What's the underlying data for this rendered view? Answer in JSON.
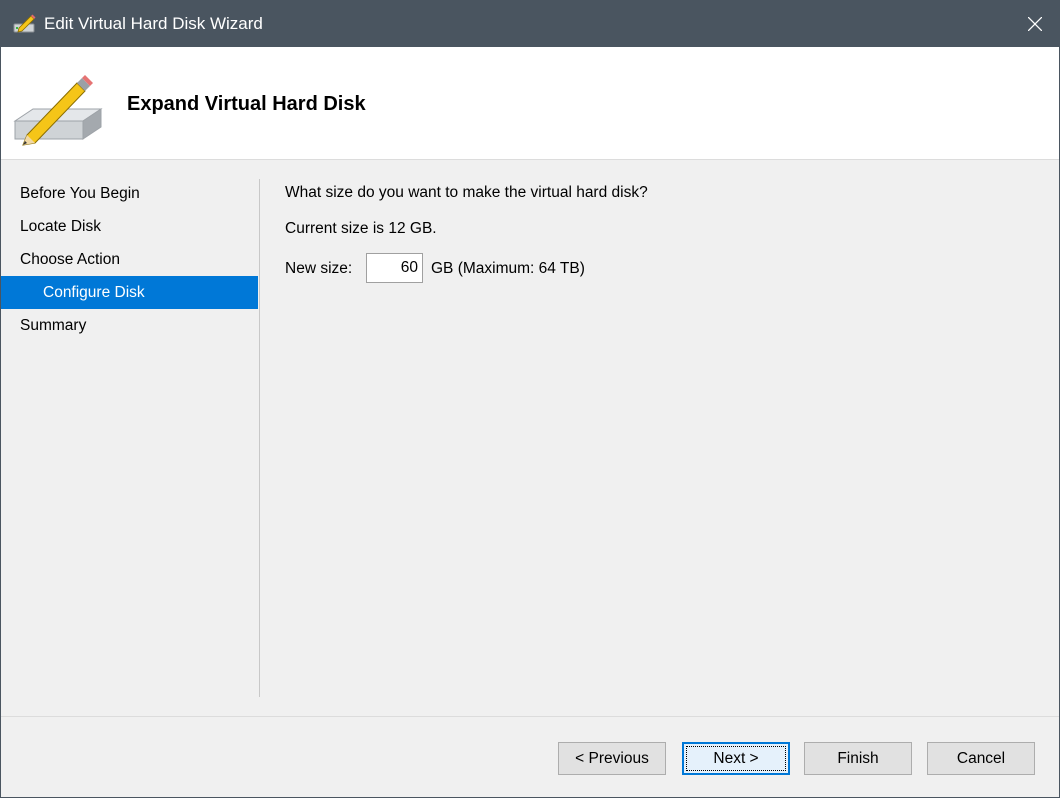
{
  "window": {
    "title": "Edit Virtual Hard Disk Wizard",
    "title_icon": "wizard-disk-icon",
    "close_icon": "close-icon"
  },
  "header": {
    "title": "Expand Virtual Hard Disk",
    "icon": "hard-disk-pencil-icon"
  },
  "nav": {
    "items": [
      {
        "label": "Before You Begin",
        "active": false
      },
      {
        "label": "Locate Disk",
        "active": false
      },
      {
        "label": "Choose Action",
        "active": false
      },
      {
        "label": "Configure Disk",
        "active": true
      },
      {
        "label": "Summary",
        "active": false
      }
    ]
  },
  "content": {
    "question": "What size do you want to make the virtual hard disk?",
    "current_size": "Current size is 12 GB.",
    "new_size_label": "New size:",
    "new_size_value": "60",
    "unit_text": "GB (Maximum: 64 TB)"
  },
  "buttons": {
    "previous": "< Previous",
    "next": "Next >",
    "finish": "Finish",
    "cancel": "Cancel"
  },
  "colors": {
    "titlebar": "#4a5560",
    "accent": "#0078d7",
    "background": "#f0f0f0"
  }
}
